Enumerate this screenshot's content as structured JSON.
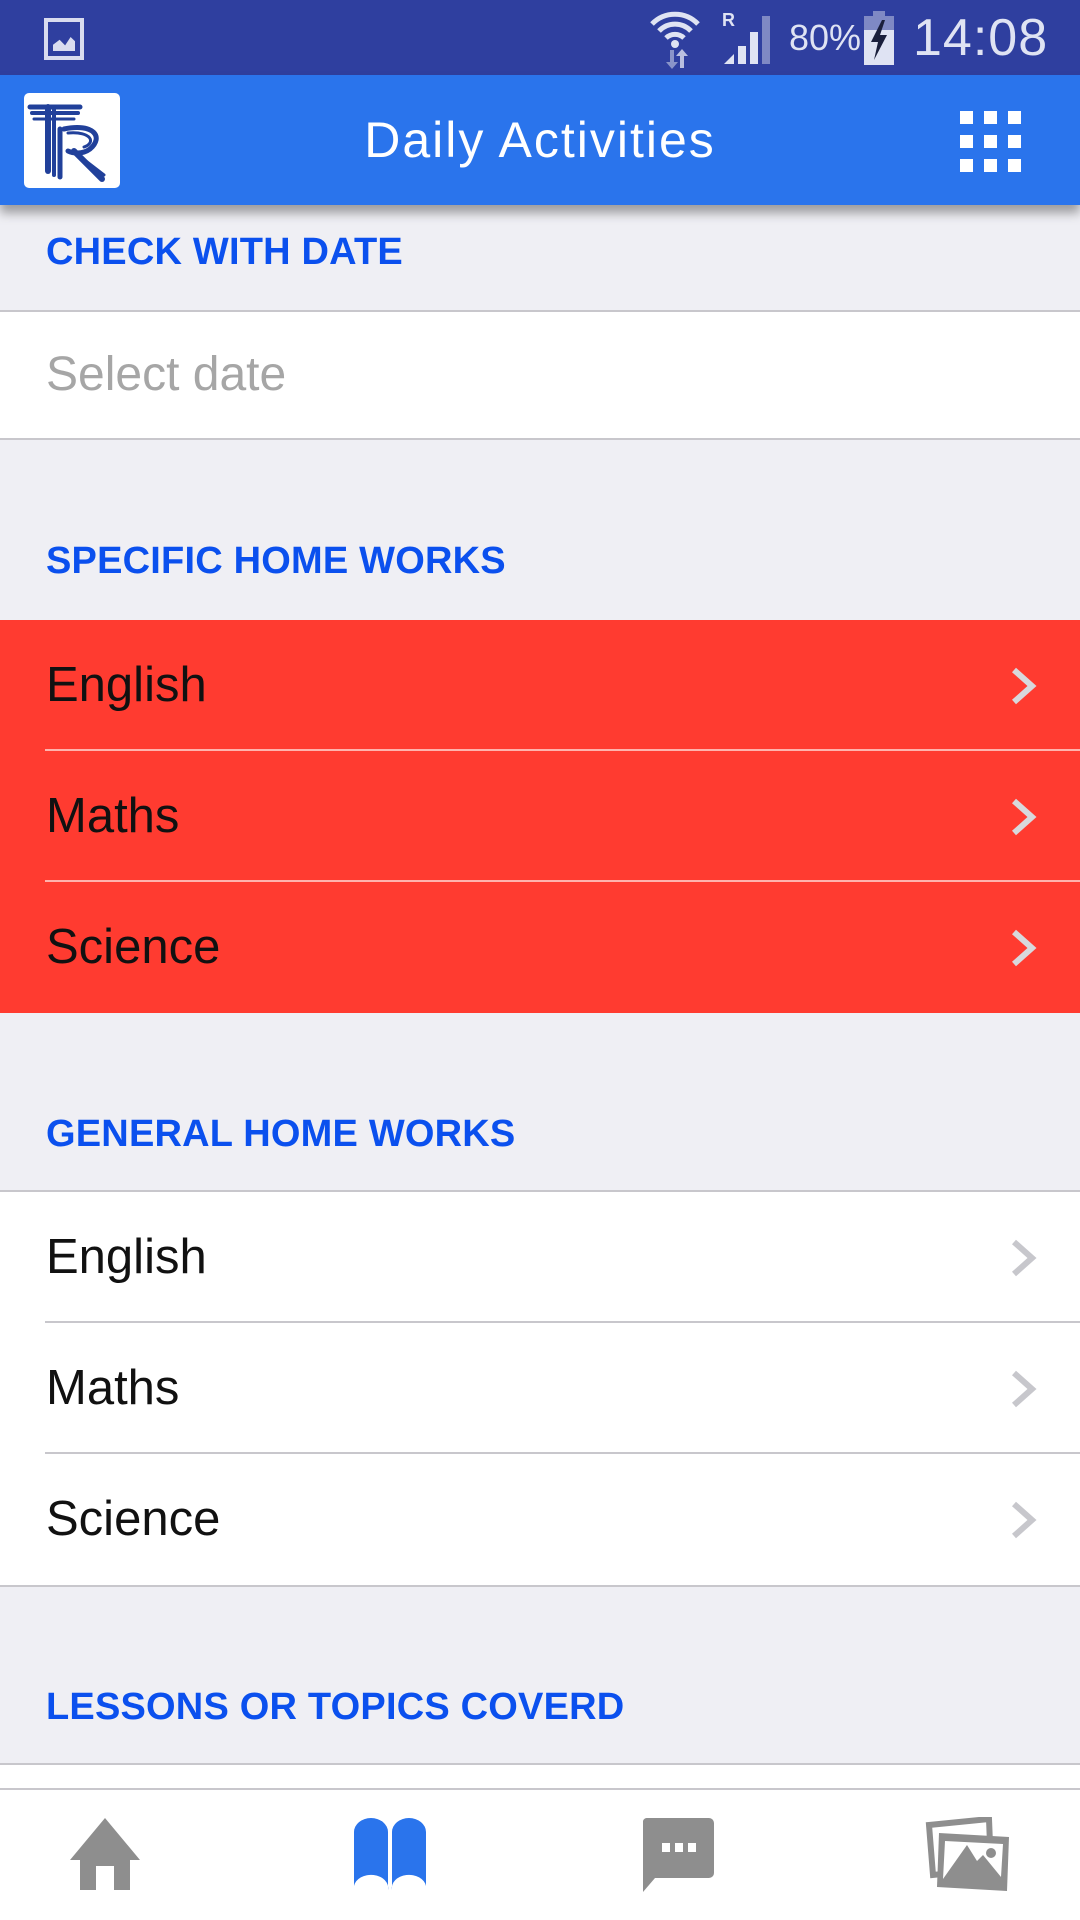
{
  "status_bar": {
    "notification_icon": "gallery-icon",
    "wifi_icon": "wifi-icon",
    "signal_icon": "signal-roaming-icon",
    "roaming_label": "R",
    "battery_percent": "80%",
    "battery_icon": "battery-charging-icon",
    "time": "14:08"
  },
  "app_bar": {
    "logo_text": "TR",
    "title": "Daily Activities",
    "menu_icon": "grid-icon"
  },
  "sections": {
    "check_with_date": {
      "header": "CHECK WITH DATE",
      "date_placeholder": "Select date"
    },
    "specific_home_works": {
      "header": "SPECIFIC HOME WORKS",
      "items": [
        {
          "label": "English"
        },
        {
          "label": "Maths"
        },
        {
          "label": "Science"
        }
      ]
    },
    "general_home_works": {
      "header": "GENERAL HOME WORKS",
      "items": [
        {
          "label": "English"
        },
        {
          "label": "Maths"
        },
        {
          "label": "Science"
        }
      ]
    },
    "lessons": {
      "header": "LESSONS OR TOPICS COVERD"
    }
  },
  "tab_bar": {
    "tabs": [
      {
        "name": "home",
        "icon": "home-icon",
        "active": false
      },
      {
        "name": "activities",
        "icon": "book-icon",
        "active": true
      },
      {
        "name": "messages",
        "icon": "chat-icon",
        "active": false
      },
      {
        "name": "gallery",
        "icon": "photos-icon",
        "active": false
      }
    ]
  },
  "colors": {
    "status_bar": "#2f3f9f",
    "app_bar": "#2a74ec",
    "section_header_text": "#0b50ee",
    "highlight_row": "#ff3b30",
    "background": "#efeff4",
    "tab_active": "#2a74ec",
    "tab_inactive": "#8e8e8e"
  }
}
